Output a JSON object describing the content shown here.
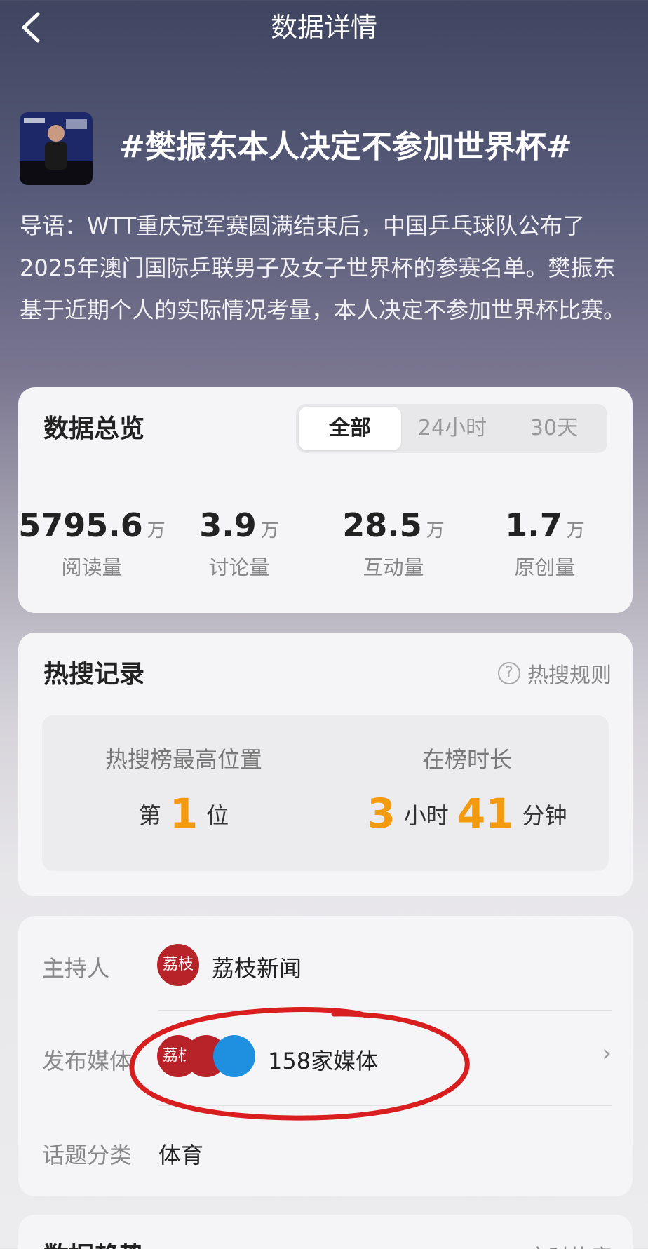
{
  "header": {
    "title": "数据详情"
  },
  "topic": {
    "title": "#樊振东本人决定不参加世界杯#",
    "lead": "导语：WTT重庆冠军赛圆满结束后，中国乒乓球队公布了2025年澳门国际乒联男子及女子世界杯的参赛名单。樊振东基于近期个人的实际情况考量，本人决定不参加世界杯比赛。"
  },
  "overview": {
    "title": "数据总览",
    "tabs": [
      "全部",
      "24小时",
      "30天"
    ],
    "active_tab": "全部",
    "stats": [
      {
        "value": "5795.6",
        "unit": "万",
        "label": "阅读量"
      },
      {
        "value": "3.9",
        "unit": "万",
        "label": "讨论量"
      },
      {
        "value": "28.5",
        "unit": "万",
        "label": "互动量"
      },
      {
        "value": "1.7",
        "unit": "万",
        "label": "原创量"
      }
    ]
  },
  "hot": {
    "title": "热搜记录",
    "rule_link": "热搜规则",
    "highest_label": "热搜榜最高位置",
    "highest_prefix": "第",
    "highest_value": "1",
    "highest_suffix": "位",
    "duration_label": "在榜时长",
    "hours": "3",
    "hours_unit": "小时",
    "minutes": "41",
    "minutes_unit": "分钟"
  },
  "info": {
    "host_label": "主持人",
    "host_name": "荔枝新闻",
    "host_avatar_text": "荔枝",
    "media_label": "发布媒体",
    "media_count": "158家媒体",
    "category_label": "话题分类",
    "category_value": "体育"
  },
  "trend": {
    "title": "数据趋势",
    "realtime": "实时热度"
  },
  "colors": {
    "accent": "#f39a0e",
    "annotation": "#d81e1e"
  }
}
